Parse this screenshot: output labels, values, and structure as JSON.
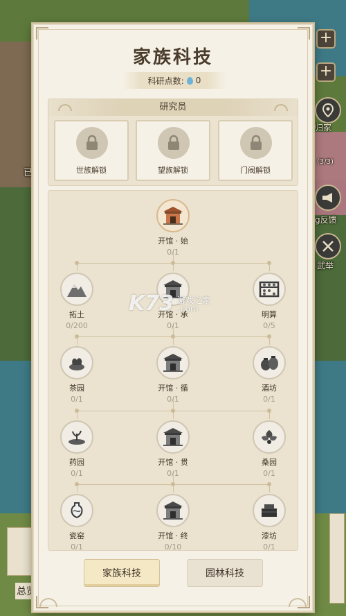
{
  "panel": {
    "title": "家族科技",
    "research_points_label": "科研点数:",
    "research_points_value": "0"
  },
  "researcher": {
    "title": "研究员",
    "slots": [
      {
        "label": "世族解锁",
        "icon": "lock-icon"
      },
      {
        "label": "望族解锁",
        "icon": "lock-icon"
      },
      {
        "label": "门阀解锁",
        "icon": "lock-icon"
      }
    ]
  },
  "tech_tree": {
    "root": {
      "name": "开馆 · 始",
      "progress": "0/1",
      "icon": "gate-icon"
    },
    "rows": [
      [
        {
          "name": "拓土",
          "progress": "0/200",
          "icon": "mountain-icon"
        },
        {
          "name": "开馆 · 承",
          "progress": "0/1",
          "icon": "gate-icon"
        },
        {
          "name": "明算",
          "progress": "0/5",
          "icon": "abacus-icon"
        }
      ],
      [
        {
          "name": "茶园",
          "progress": "0/1",
          "icon": "tea-icon"
        },
        {
          "name": "开馆 · 循",
          "progress": "0/1",
          "icon": "gate-icon"
        },
        {
          "name": "酒坊",
          "progress": "0/1",
          "icon": "wine-jar-icon"
        }
      ],
      [
        {
          "name": "药园",
          "progress": "0/1",
          "icon": "herb-icon"
        },
        {
          "name": "开馆 · 贯",
          "progress": "0/1",
          "icon": "gate-icon"
        },
        {
          "name": "桑园",
          "progress": "0/1",
          "icon": "mulberry-icon"
        }
      ],
      [
        {
          "name": "瓷窑",
          "progress": "0/1",
          "icon": "porcelain-icon"
        },
        {
          "name": "开馆 · 终",
          "progress": "0/10",
          "icon": "gate-icon"
        },
        {
          "name": "漆坊",
          "progress": "0/1",
          "icon": "lacquer-box-icon"
        }
      ]
    ]
  },
  "tabs": [
    {
      "label": "家族科技",
      "active": true
    },
    {
      "label": "园林科技",
      "active": false
    }
  ],
  "background_hud": {
    "left_texts": [
      "已",
      "总览"
    ],
    "right_labels": [
      "归家",
      "(3/3)",
      "g反馈",
      "武举"
    ]
  },
  "watermark": {
    "logo": "K73",
    "text": "游戏之家",
    "url": ".com"
  }
}
